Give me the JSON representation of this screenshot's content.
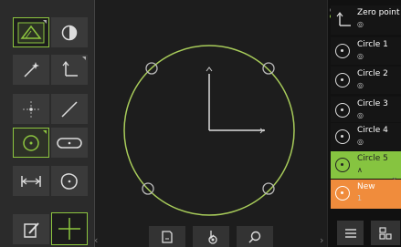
{
  "tools": [
    {
      "id": "measure-probe",
      "icon": "triangle-probe-icon"
    },
    {
      "id": "contrast",
      "icon": "contrast-icon"
    },
    {
      "id": "auto-detect",
      "icon": "magic-wand-icon"
    },
    {
      "id": "coordinate-system",
      "icon": "axis-icon"
    },
    {
      "id": "point",
      "icon": "point-icon"
    },
    {
      "id": "line",
      "icon": "line-icon"
    },
    {
      "id": "circle",
      "icon": "circle-icon"
    },
    {
      "id": "slot",
      "icon": "slot-icon"
    },
    {
      "id": "distance",
      "icon": "distance-icon"
    },
    {
      "id": "blob",
      "icon": "blob-icon"
    },
    {
      "id": "manual-measure",
      "icon": "edit-icon"
    },
    {
      "id": "crosshair",
      "icon": "crosshair-icon"
    }
  ],
  "feature_list": {
    "items": [
      {
        "name": "Zero point",
        "sub": "◎",
        "state": "normal",
        "icon": "axis-icon"
      },
      {
        "name": "Circle 1",
        "sub": "◎",
        "state": "normal",
        "icon": "circle-icon"
      },
      {
        "name": "Circle 2",
        "sub": "◎",
        "state": "normal",
        "icon": "circle-icon"
      },
      {
        "name": "Circle 3",
        "sub": "◎",
        "state": "normal",
        "icon": "circle-icon"
      },
      {
        "name": "Circle 4",
        "sub": "◎",
        "state": "normal",
        "icon": "circle-icon"
      },
      {
        "name": "Circle 5",
        "sub": "∧",
        "state": "active",
        "icon": "circle-icon"
      },
      {
        "name": "New",
        "sub": "1",
        "state": "new",
        "icon": "circle-icon"
      }
    ]
  },
  "bottom_bar": {
    "buttons": [
      "document-icon",
      "zoom-settings-icon",
      "search-icon"
    ]
  },
  "colors": {
    "accent_green": "#86c440",
    "new_orange": "#f08c3c",
    "circle_stroke": "#a8cc5a"
  }
}
